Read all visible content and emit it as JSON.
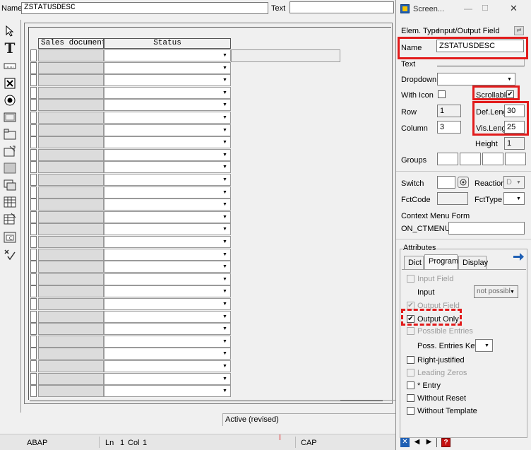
{
  "topbar": {
    "name_label": "Name",
    "name_value": "ZSTATUSDESC",
    "text_label": "Text"
  },
  "table": {
    "headers": [
      "Sales document",
      "Status"
    ],
    "row_count": 28
  },
  "statusbar": {
    "active_text": "Active (revised)",
    "lang": "ABAP",
    "ln_label": "Ln",
    "ln_value": "1",
    "col_label": "Col",
    "col_value": "1",
    "cap": "CAP"
  },
  "panel": {
    "title": "Screen...",
    "elem_type_label": "Elem. Type",
    "elem_type_value": "Input/Output Field",
    "name_label": "Name",
    "name_value": "ZSTATUSDESC",
    "text_label": "Text",
    "dropdown_label": "Dropdown",
    "with_icon_label": "With Icon",
    "scrollable_label": "Scrollable",
    "row_label": "Row",
    "row_value": "1",
    "column_label": "Column",
    "column_value": "3",
    "def_length_label": "Def.Lengt",
    "def_length_value": "30",
    "vis_length_label": "Vis.Length",
    "vis_length_value": "25",
    "height_label": "Height",
    "height_value": "1",
    "groups_label": "Groups",
    "switch_label": "Switch",
    "reaction_label": "Reaction",
    "reaction_value": "D",
    "fctcode_label": "FctCode",
    "fcttype_label": "FctType",
    "context_menu_label": "Context Menu Form",
    "context_menu_value": "ON_CTMENU_",
    "attributes_label": "Attributes",
    "tabs": [
      "Dict",
      "Program",
      "Display"
    ],
    "input_field_label": "Input Field",
    "input_label": "Input",
    "input_value": "not possibl",
    "output_field_label": "Output Field",
    "output_only_label": "Output Only",
    "possible_entries_label": "Possible Entries",
    "poss_entries_key_label": "Poss. Entries Key",
    "right_justified_label": "Right-justified",
    "leading_zeros_label": "Leading Zeros",
    "star_entry_label": "* Entry",
    "without_reset_label": "Without Reset",
    "without_template_label": "Without Template"
  },
  "colors": {
    "highlight": "#e21b1b",
    "accent_blue": "#1e5fb4"
  }
}
